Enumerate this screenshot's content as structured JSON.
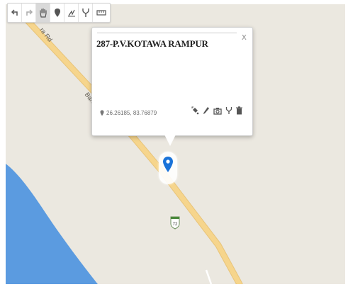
{
  "map": {
    "road_name_left": "ra Rd",
    "road_name_mid": "Barh",
    "shield_number": "72",
    "colors": {
      "land": "#ebe8e0",
      "water": "#5b9be0",
      "road": "#f6d58c",
      "marker": "#1a73d9"
    }
  },
  "toolbar": {
    "buttons": [
      {
        "icon": "undo-icon",
        "active": false
      },
      {
        "icon": "redo-icon",
        "active": false
      },
      {
        "icon": "hand-icon",
        "active": true
      },
      {
        "icon": "marker-icon",
        "active": false
      },
      {
        "icon": "draw-line-icon",
        "active": false
      },
      {
        "icon": "fork-icon",
        "active": false
      },
      {
        "icon": "ruler-icon",
        "active": false
      }
    ]
  },
  "popup": {
    "title": "287-P.V.KOTAWA RAMPUR",
    "coordinates": "26.26185, 83.76879",
    "close_label": "x",
    "actions": [
      "paint-bucket-icon",
      "pencil-icon",
      "camera-icon",
      "fork-icon",
      "trash-icon"
    ]
  }
}
